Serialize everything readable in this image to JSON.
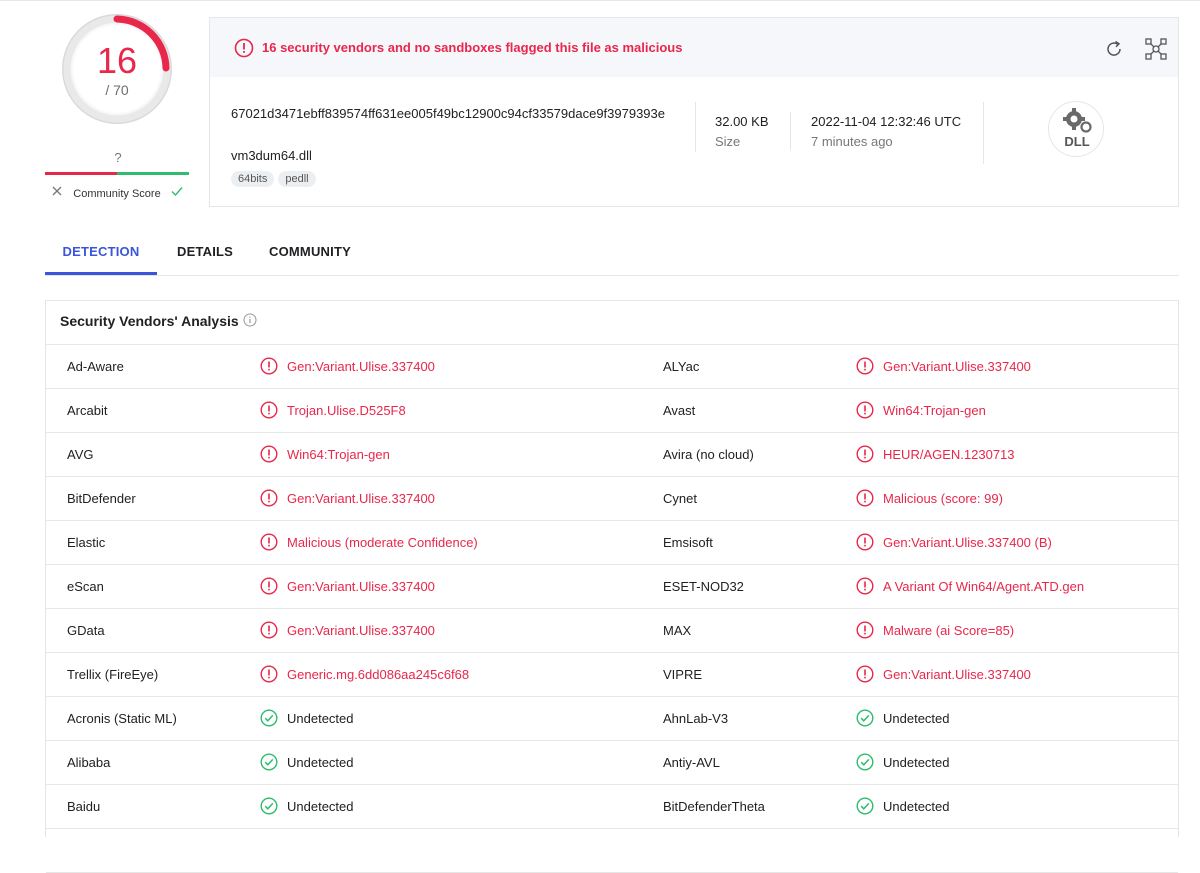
{
  "score": {
    "detections": "16",
    "total": "/ 70",
    "community_unknown": "?",
    "community_label": "Community Score"
  },
  "alert": {
    "text": "16 security vendors and no sandboxes flagged this file as malicious"
  },
  "file": {
    "hash": "67021d3471ebff839574ff631ee005f49bc12900c94cf33579dace9f3979393e",
    "name": "vm3dum64.dll",
    "tags": [
      "64bits",
      "pedll"
    ],
    "size": "32.00 KB",
    "size_label": "Size",
    "date": "2022-11-04 12:32:46 UTC",
    "date_ago": "7 minutes ago",
    "type_badge": "DLL"
  },
  "tabs": [
    "DETECTION",
    "DETAILS",
    "COMMUNITY"
  ],
  "panel": {
    "title": "Security Vendors' Analysis"
  },
  "colors": {
    "malicious": "#e8274b",
    "clean": "#2ebc6e",
    "accent": "#3a55d9"
  },
  "vendors": [
    {
      "left": {
        "name": "Ad-Aware",
        "result": "Gen:Variant.Ulise.337400",
        "status": "malicious"
      },
      "right": {
        "name": "ALYac",
        "result": "Gen:Variant.Ulise.337400",
        "status": "malicious"
      }
    },
    {
      "left": {
        "name": "Arcabit",
        "result": "Trojan.Ulise.D525F8",
        "status": "malicious"
      },
      "right": {
        "name": "Avast",
        "result": "Win64:Trojan-gen",
        "status": "malicious"
      }
    },
    {
      "left": {
        "name": "AVG",
        "result": "Win64:Trojan-gen",
        "status": "malicious"
      },
      "right": {
        "name": "Avira (no cloud)",
        "result": "HEUR/AGEN.1230713",
        "status": "malicious"
      }
    },
    {
      "left": {
        "name": "BitDefender",
        "result": "Gen:Variant.Ulise.337400",
        "status": "malicious"
      },
      "right": {
        "name": "Cynet",
        "result": "Malicious (score: 99)",
        "status": "malicious"
      }
    },
    {
      "left": {
        "name": "Elastic",
        "result": "Malicious (moderate Confidence)",
        "status": "malicious"
      },
      "right": {
        "name": "Emsisoft",
        "result": "Gen:Variant.Ulise.337400 (B)",
        "status": "malicious"
      }
    },
    {
      "left": {
        "name": "eScan",
        "result": "Gen:Variant.Ulise.337400",
        "status": "malicious"
      },
      "right": {
        "name": "ESET-NOD32",
        "result": "A Variant Of Win64/Agent.ATD.gen",
        "status": "malicious"
      }
    },
    {
      "left": {
        "name": "GData",
        "result": "Gen:Variant.Ulise.337400",
        "status": "malicious"
      },
      "right": {
        "name": "MAX",
        "result": "Malware (ai Score=85)",
        "status": "malicious"
      }
    },
    {
      "left": {
        "name": "Trellix (FireEye)",
        "result": "Generic.mg.6dd086aa245c6f68",
        "status": "malicious"
      },
      "right": {
        "name": "VIPRE",
        "result": "Gen:Variant.Ulise.337400",
        "status": "malicious"
      }
    },
    {
      "left": {
        "name": "Acronis (Static ML)",
        "result": "Undetected",
        "status": "undetected"
      },
      "right": {
        "name": "AhnLab-V3",
        "result": "Undetected",
        "status": "undetected"
      }
    },
    {
      "left": {
        "name": "Alibaba",
        "result": "Undetected",
        "status": "undetected"
      },
      "right": {
        "name": "Antiy-AVL",
        "result": "Undetected",
        "status": "undetected"
      }
    },
    {
      "left": {
        "name": "Baidu",
        "result": "Undetected",
        "status": "undetected"
      },
      "right": {
        "name": "BitDefenderTheta",
        "result": "Undetected",
        "status": "undetected"
      }
    },
    {
      "left": {
        "name": "",
        "result": "",
        "status": ""
      },
      "right": {
        "name": "",
        "result": "",
        "status": ""
      }
    }
  ]
}
